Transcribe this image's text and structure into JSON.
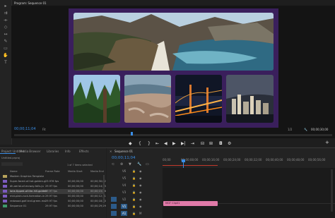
{
  "window_title": "Program: Sequence 01",
  "tools": [
    "selection-icon",
    "track-select-icon",
    "ripple-icon",
    "razor-icon",
    "slip-icon",
    "pen-icon",
    "rectangle-icon",
    "hand-icon",
    "type-icon"
  ],
  "program": {
    "timecode": "00;00;11;04",
    "fit_label": "Fit",
    "quality_label": "1/2",
    "duration": "00;00;30;00",
    "transport": [
      "◆",
      "{",
      "|◀",
      "◀|",
      "▶",
      "|▶",
      "▶|",
      "⊟",
      "⊞",
      "📷",
      "⚙"
    ]
  },
  "project_panel": {
    "tabs": [
      "Project: Untitled",
      "Media Browser",
      "Libraries",
      "Info",
      "Effects"
    ],
    "project_name": "Untitled.prproj",
    "selection_info": "1 of 7 items selected",
    "columns": [
      "Name",
      "Frame Rate",
      "Media Start",
      "Media End"
    ],
    "items": [
      {
        "name": "Modern Graphics Template",
        "rate": "",
        "start": "",
        "end": ""
      },
      {
        "name": "Super-faced-of-hot-golden-g",
        "rate": "23.976 fps",
        "start": "00;00;00;00",
        "end": "00;00;30;02"
      },
      {
        "name": "dh-aerial-of-mcway-falls-ju",
        "rate": "29.97 fps",
        "start": "00;00;00;00",
        "end": "00;00;14;23"
      },
      {
        "name": "lone-tipped-of-the-hill-golden",
        "rate": "29.97 fps",
        "start": "00;00;00;00",
        "end": "00;00;15;28"
      },
      {
        "name": "mid-plain-rock-formation-in",
        "rate": "29.97 fps",
        "start": "00;00;00;00",
        "end": "00;00;12;11"
      },
      {
        "name": "redwood-golf-trail-green-ma",
        "rate": "29.97 fps",
        "start": "00;00;00;00",
        "end": "00;00;18;20"
      },
      {
        "name": "Sequence 01",
        "rate": "29.97 fps",
        "start": "00;00;00;00",
        "end": "00;00;29;29"
      }
    ]
  },
  "timeline": {
    "tab": "Sequence 01",
    "timecode": "00;00;11;04",
    "ruler": [
      "00;00",
      "00;00;08;00",
      "00;00;16;00",
      "00;00;24;00",
      "00;00;32;00",
      "00;00;40;00",
      "00;00;48;00",
      "00;00;56;00",
      "00;01;04;00"
    ],
    "tracks": [
      "V6",
      "V5",
      "V4",
      "V3",
      "V2",
      "V1",
      "A1",
      "A2",
      "A3"
    ],
    "clip_label": "MGT Clip01",
    "clip_color": "#e07aa8"
  },
  "accent": "#3a8ee6"
}
